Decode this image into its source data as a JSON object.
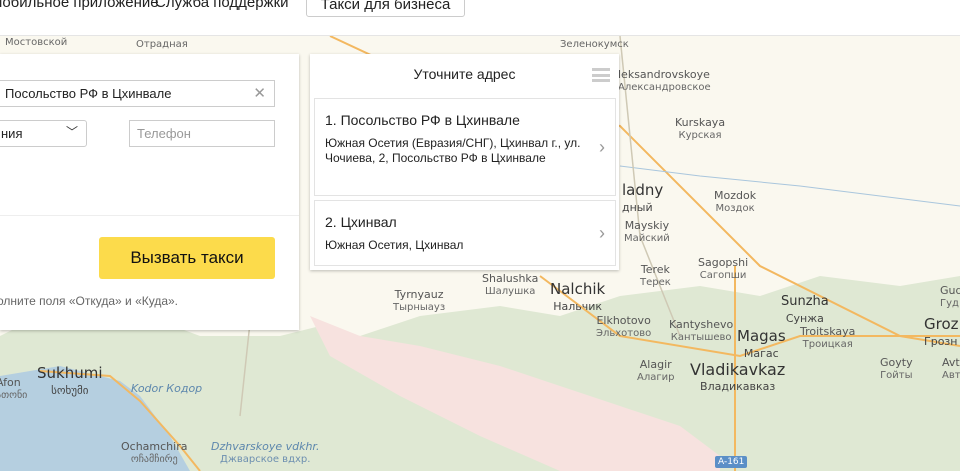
{
  "header": {
    "nav": [
      "мобильное приложение",
      "Служба поддержки"
    ],
    "business_button": "Такси для бизнеса"
  },
  "form": {
    "from_value": "Посольство РФ в Цхинвале",
    "tariff_value": "ния",
    "phone_placeholder": "Телефон",
    "call_button": "Вызвать такси",
    "hint": "олните поля «Откуда» и «Куда»."
  },
  "popup": {
    "title": "Уточните адрес",
    "items": [
      {
        "title": "1. Посольство РФ в Цхинвале",
        "subtitle": "Южная Осетия (Евразия/СНГ), Цхинвал г., ул. Чочиева, 2, Посольство РФ в Цхинвале"
      },
      {
        "title": "2. Цхинвал",
        "subtitle": "Южная Осетия, Цхинвал"
      }
    ]
  },
  "map": {
    "labels": [
      {
        "en": "",
        "ru": "Мостовской"
      },
      {
        "en": "",
        "ru": "Отрадная"
      },
      {
        "en": "",
        "ru": "Зеленокумск"
      },
      {
        "en": "leksandrovskoye",
        "ru": "Александровское"
      },
      {
        "en": "Kurskaya",
        "ru": "Курская"
      },
      {
        "en": "ladny",
        "ru": "дный"
      },
      {
        "en": "Mozdok",
        "ru": "Моздок"
      },
      {
        "en": "Mayskiy",
        "ru": "Майский"
      },
      {
        "en": "Terek",
        "ru": "Терек"
      },
      {
        "en": "Sagopshi",
        "ru": "Сагопши"
      },
      {
        "en": "Shalushka",
        "ru": "Шалушка"
      },
      {
        "en": "Nalchik",
        "ru": "Нальчик"
      },
      {
        "en": "Tyrnyauz",
        "ru": "Тырныауз"
      },
      {
        "en": "Elkhotovo",
        "ru": "Эльхотово"
      },
      {
        "en": "Kantyshevo",
        "ru": "Кантышево"
      },
      {
        "en": "Magas",
        "ru": "Магас"
      },
      {
        "en": "Sunzha",
        "ru": "Сунжа"
      },
      {
        "en": "Troitskaya",
        "ru": "Троицкая"
      },
      {
        "en": "Groz",
        "ru": "Грозн"
      },
      {
        "en": "Gud",
        "ru": "Гуд"
      },
      {
        "en": "Goyty",
        "ru": "Гойты"
      },
      {
        "en": "Avt",
        "ru": "Авту"
      },
      {
        "en": "Alagir",
        "ru": "Алагир"
      },
      {
        "en": "Vladikavkaz",
        "ru": "Владикавказ"
      },
      {
        "en": "Sukhumi",
        "ru": "სოხუმი"
      },
      {
        "en": "Afon",
        "ru": "ათონი"
      },
      {
        "en": "Kodor",
        "ru": "Кодор"
      },
      {
        "en": "Ochamchira",
        "ru": "ოჩამჩირე"
      },
      {
        "en": "Dzhvarskoye vdkhr.",
        "ru": "Джварское вдхр."
      }
    ],
    "road_badge": "A-161",
    "colors": {
      "land": "#faf8ef",
      "forest": "#dfe8d3",
      "mountain": "#f7dede",
      "sea": "#b5cfe0",
      "road": "#f3b860"
    }
  }
}
